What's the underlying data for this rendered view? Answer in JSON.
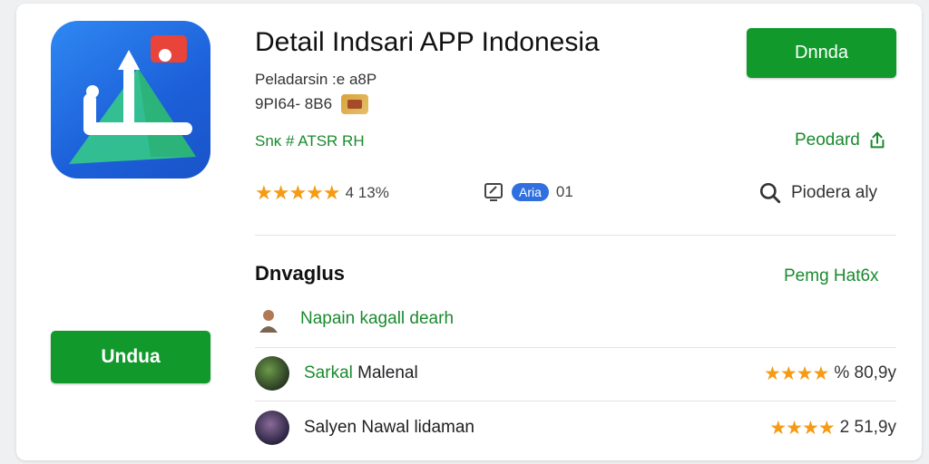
{
  "app": {
    "title": "Detail Indsari APP Indonesia",
    "subtitle_1": "Peladarsin :e a8P",
    "subtitle_2": "9PI64- 8B6",
    "tagline": "Snĸ # ATSR RH",
    "download_label": "Dnnda",
    "pendard_label": "Peodard",
    "colors": {
      "primary_green": "#119a2b",
      "link_green": "#1a8a2e",
      "star": "#f59b14",
      "icon_blue": "#2f88f2"
    }
  },
  "stats": {
    "rating_text": "4 13%",
    "star_count": 5,
    "device_pill": "Aria",
    "device_num": "01",
    "search_label": "Piodera aly"
  },
  "left": {
    "download_button": "Undua"
  },
  "section": {
    "title": "Dnvaglus",
    "link": "Pemg Hat6x",
    "first_item": "Napain kagall dearh",
    "reviews": [
      {
        "name_green": "Sarkal",
        "name_rest": " Malenal",
        "stars": "★★★★",
        "value": "% 80,9y"
      },
      {
        "name_green": "",
        "name_rest": "Salyen Nawal lidaman",
        "stars": "★★★★",
        "value": "2 51,9y"
      }
    ]
  },
  "icons": [
    "app-logo-icon",
    "badge-icon",
    "share-icon",
    "device-icon",
    "search-icon",
    "avatar-icon"
  ]
}
